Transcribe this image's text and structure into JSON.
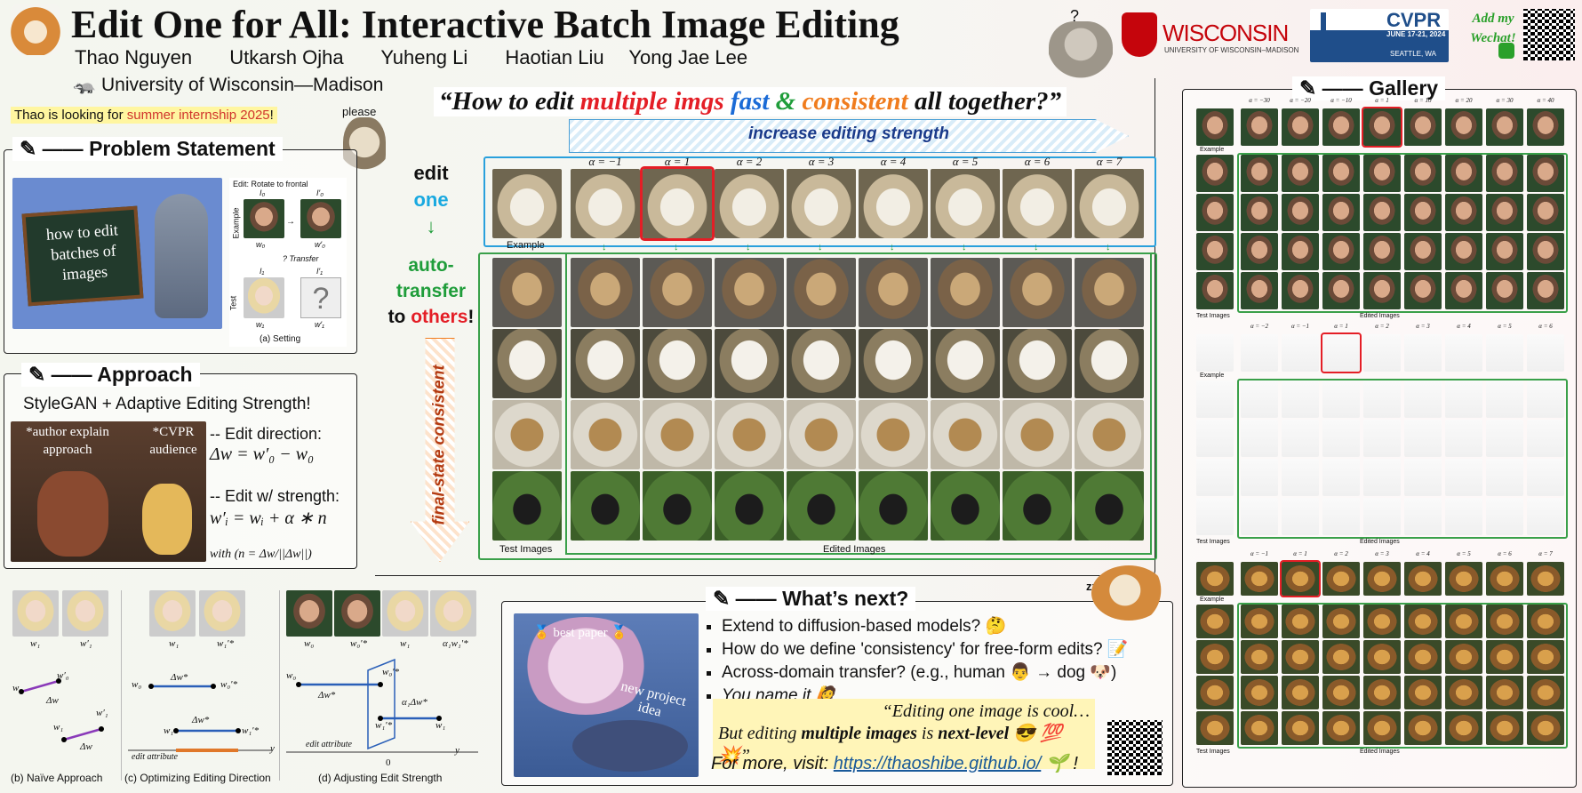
{
  "header": {
    "title": "Edit One for All: Interactive Batch Image Editing",
    "authors": [
      "Thao Nguyen",
      "Utkarsh Ojha",
      "Yuheng Li",
      "Haotian Liu",
      "Yong Jae Lee"
    ],
    "affiliation": "🦡 University of Wisconsin—Madison",
    "question_mark": "?",
    "internship_prefix": "Thao is looking for ",
    "internship_highlight": "summer internship 2025",
    "internship_suffix": "!",
    "please": "please",
    "wisconsin": "WISCONSIN",
    "wisconsin_sub": "UNIVERSITY OF WISCONSIN–MADISON",
    "cvpr": "CVPR",
    "cvpr_dates": "JUNE 17-21, 2024",
    "cvpr_city": "SEATTLE, WA",
    "wechat": "Add my Wechat!"
  },
  "problem": {
    "title": "Problem Statement",
    "chalk": "how to edit batches of images",
    "edit_label": "Edit: Rotate to frontal",
    "example": "Example",
    "test": "Test",
    "transfer": "? Transfer",
    "i0": "I₀",
    "i0p": "I′₀",
    "i1": "I₁",
    "i1p": "I′₁",
    "w0": "w₀",
    "w0p": "w′₀",
    "w1": "w₁",
    "w1p": "w′₁",
    "qmark": "?",
    "caption": "(a) Setting"
  },
  "approach": {
    "title": "Approach",
    "subtitle": "StyleGAN + Adaptive Editing Strength!",
    "tag_author": "*author explain approach",
    "tag_cvpr": "*CVPR audience",
    "edit_dir": "-- Edit direction:",
    "eq1": "Δw = w′₀ − w₀",
    "edit_strength": "-- Edit w/ strength:",
    "eq2": "w′ᵢ = wᵢ + α ∗ n",
    "with": "with (n = Δw/||Δw||)"
  },
  "bottom_left": {
    "b_caption": "(b) Naïve Approach",
    "c_caption": "(c) Optimizing Editing Direction",
    "d_caption": "(d) Adjusting Edit Strength",
    "edit_attr": "edit attribute",
    "w0": "w₀",
    "w0p": "w′₀",
    "w1": "w₁",
    "w1p": "w′₁",
    "w0s": "w₀′*",
    "w1s": "w₁′*",
    "a1w1": "α₁w₁′*",
    "delta_w": "Δw",
    "delta_ws": "Δw*",
    "a1_delta": "α₁Δw*",
    "zero": "0",
    "y": "y"
  },
  "center": {
    "quote_open": "“How to edit ",
    "quote_multiple": "multiple",
    "quote_imgs": "imgs",
    "quote_fast": "fast",
    "quote_amp": "&",
    "quote_consistent": "consistent",
    "quote_close": "all together?”",
    "arrow_label": "increase editing strength",
    "alphas": [
      "α = −1",
      "α = 1",
      "α = 2",
      "α = 3",
      "α = 4",
      "α = 5",
      "α = 6",
      "α = 7"
    ],
    "edit": "edit",
    "one": "one",
    "auto": "auto-",
    "transfer": "transfer",
    "to": "to",
    "others": "others",
    "excl": "!",
    "final_state": "final-state consistent",
    "example": "Example",
    "test_images": "Test Images",
    "edited_images": "Edited Images",
    "row_types": [
      "pug",
      "lab",
      "brown",
      "black"
    ]
  },
  "next": {
    "title": "What’s next?",
    "zzz": "zzz",
    "best_paper": "🏅 best paper 🏅",
    "new_project": "new project idea",
    "items": [
      "Extend to diffusion-based models? 🤔",
      "How do we define 'consistency' for free-form edits? 📝",
      "Across-domain transfer? (e.g., human 👨 → dog 🐶)",
      "You name it 🙋"
    ],
    "quote_line1": "“Editing one image is cool…",
    "quote_line2_pre": "But editing ",
    "quote_line2_bold": "multiple images",
    "quote_line2_mid": " is ",
    "quote_line2_bold2": "next-level",
    "quote_line2_post": " 😎 💯 💥”",
    "visit": "For more, visit: ",
    "link": "https://thaoshibe.github.io/",
    "visit_end": " 🌱 !"
  },
  "gallery": {
    "title": "Gallery",
    "faces_alphas": [
      "α = −30",
      "α = −20",
      "α = −10",
      "α = 1",
      "α = 10",
      "α = 20",
      "α = 30",
      "α = 40"
    ],
    "fig_alphas": [
      "α = −2",
      "α = −1",
      "α = 1",
      "α = 2",
      "α = 3",
      "α = 4",
      "α = 5",
      "α = 6"
    ],
    "lion_alphas": [
      "α = −1",
      "α = 1",
      "α = 2",
      "α = 3",
      "α = 4",
      "α = 5",
      "α = 6",
      "α = 7"
    ],
    "example": "Example",
    "test_images": "Test Images",
    "edited_images": "Edited Images"
  }
}
